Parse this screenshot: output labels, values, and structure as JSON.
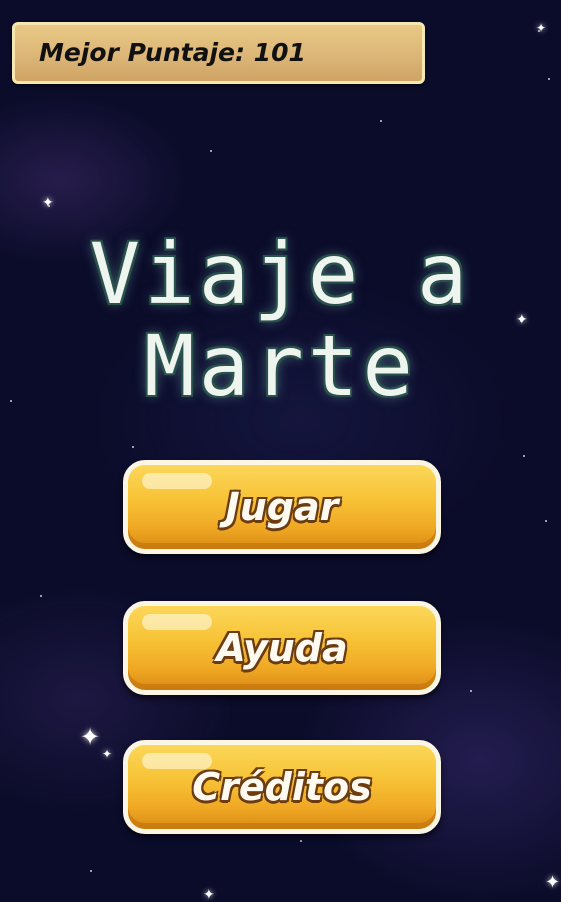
{
  "hud": {
    "best_score_label": "Mejor Puntaje: 101"
  },
  "title": {
    "line1": "Viaje a",
    "line2": "Marte"
  },
  "menu": {
    "play_label": "Jugar",
    "help_label": "Ayuda",
    "credits_label": "Créditos"
  },
  "colors": {
    "background": "#0b0c2a",
    "panel": "#dcb678",
    "button": "#f7c337",
    "title_text": "#eef4ee"
  }
}
